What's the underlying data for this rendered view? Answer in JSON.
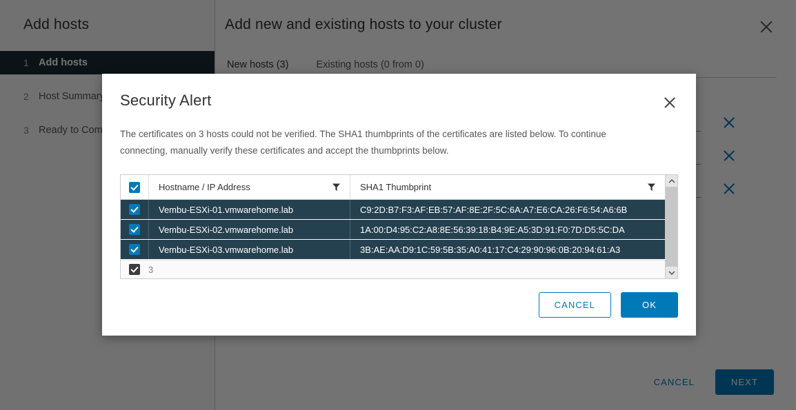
{
  "wizard": {
    "sidebar_title": "Add hosts",
    "steps": [
      {
        "num": "1",
        "label": "Add hosts",
        "active": true
      },
      {
        "num": "2",
        "label": "Host Summary",
        "active": false
      },
      {
        "num": "3",
        "label": "Ready to Complete",
        "active": false
      }
    ],
    "main_title": "Add new and existing hosts to your cluster",
    "close_icon": "close-icon",
    "tabs": [
      {
        "label": "New hosts (3)",
        "active": true
      },
      {
        "label": "Existing hosts (0 from 0)",
        "active": false
      }
    ],
    "host_rows": [
      {
        "value": "",
        "remove_icon": "remove-icon"
      },
      {
        "value": "",
        "remove_icon": "remove-icon"
      },
      {
        "value": "",
        "remove_icon": "remove-icon"
      }
    ],
    "footer": {
      "cancel_label": "CANCEL",
      "next_label": "NEXT"
    }
  },
  "modal": {
    "title": "Security Alert",
    "close_icon": "close-icon",
    "body_text": "The certificates on 3 hosts could not be verified. The SHA1 thumbprints of the certificates are listed below. To continue connecting, manually verify these certificates and accept the thumbprints below.",
    "table": {
      "select_all_checked": true,
      "columns": [
        {
          "label": "Hostname / IP Address",
          "filter_icon": "filter-icon"
        },
        {
          "label": "SHA1 Thumbprint",
          "filter_icon": "filter-icon"
        }
      ],
      "rows": [
        {
          "checked": true,
          "hostname": "Vembu-ESXi-01.vmwarehome.lab",
          "thumbprint": "C9:2D:B7:F3:AF:EB:57:AF:8E:2F:5C:6A:A7:E6:CA:26:F6:54:A6:6B"
        },
        {
          "checked": true,
          "hostname": "Vembu-ESXi-02.vmwarehome.lab",
          "thumbprint": "1A:00:D4:95:C2:A8:8E:56:39:18:B4:9E:A5:3D:91:F0:7D:D5:5C:DA"
        },
        {
          "checked": true,
          "hostname": "Vembu-ESXi-03.vmwarehome.lab",
          "thumbprint": "3B:AE:AA:D9:1C:59:5B:35:A0:41:17:C4:29:90:96:0B:20:94:61:A3"
        }
      ],
      "footer_count": "3",
      "scroll_up_icon": "chevron-up-icon",
      "scroll_down_icon": "chevron-down-icon"
    },
    "actions": {
      "cancel_label": "CANCEL",
      "ok_label": "OK"
    }
  },
  "colors": {
    "accent": "#0079b8",
    "row_selected_bg": "#25404f",
    "step_active_bg": "#1b2a32"
  }
}
